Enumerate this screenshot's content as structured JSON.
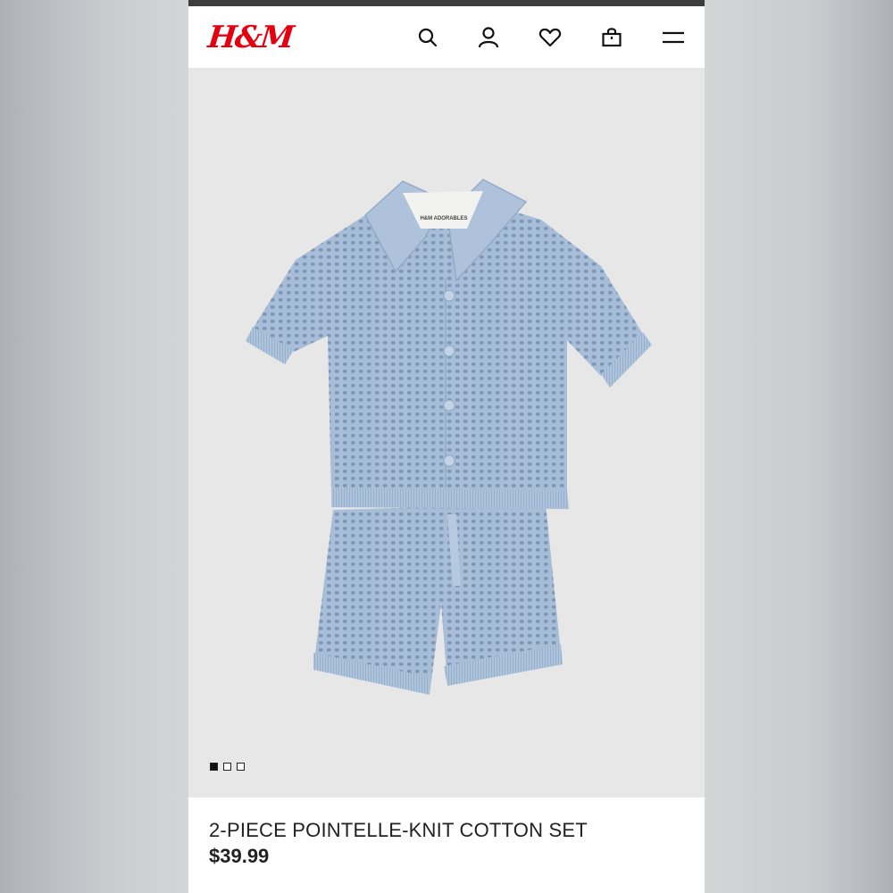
{
  "header": {
    "logo_text": "H&M",
    "icons": [
      "search-icon",
      "account-icon",
      "favorites-icon",
      "shopping-bag-icon",
      "menu-icon"
    ]
  },
  "product": {
    "title": "2-PIECE POINTELLE-KNIT COTTON SET",
    "price": "$39.99",
    "label_text": "H&M ADORABLES",
    "image_count": 3,
    "active_image_index": 1
  },
  "colors": {
    "brand": "#e50010",
    "garment": "#a9bfd9",
    "image_background": "#e7e7e8"
  }
}
